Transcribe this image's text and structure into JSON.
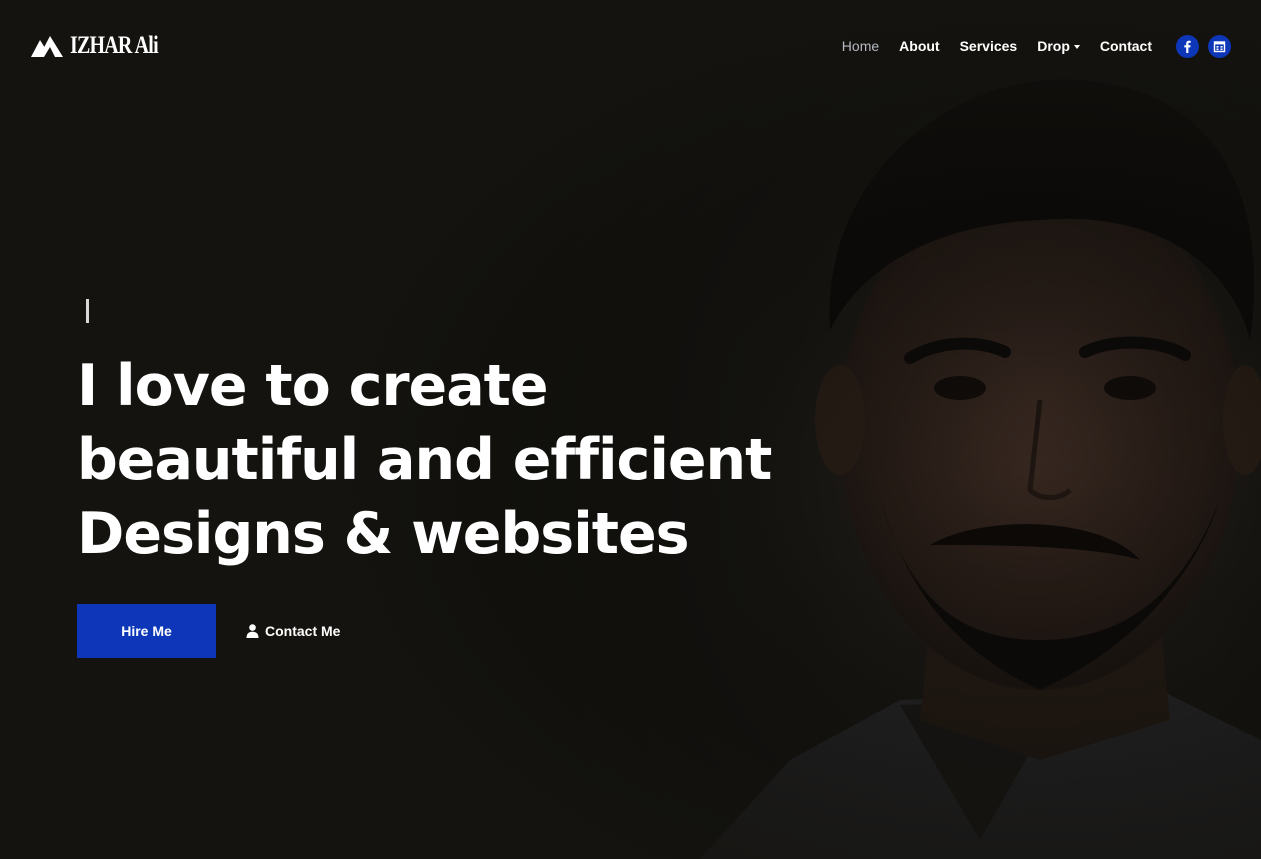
{
  "brand": {
    "name": "IZHAR Ali",
    "icon": "mountain-logo-icon"
  },
  "nav": {
    "items": [
      {
        "label": "Home",
        "active": true
      },
      {
        "label": "About"
      },
      {
        "label": "Services"
      },
      {
        "label": "Drop",
        "dropdown": true
      },
      {
        "label": "Contact"
      }
    ],
    "social": [
      {
        "icon": "facebook-icon"
      },
      {
        "icon": "calendar-icon"
      }
    ]
  },
  "hero": {
    "headline": [
      "I love to create",
      "beautiful and efficient",
      "Designs & websites"
    ],
    "primary_button": "Hire Me",
    "secondary_button": "Contact Me",
    "secondary_icon": "user-icon"
  },
  "colors": {
    "accent": "#0d37b8",
    "background": "#14130f",
    "nav_active": "#b7b9c2"
  }
}
